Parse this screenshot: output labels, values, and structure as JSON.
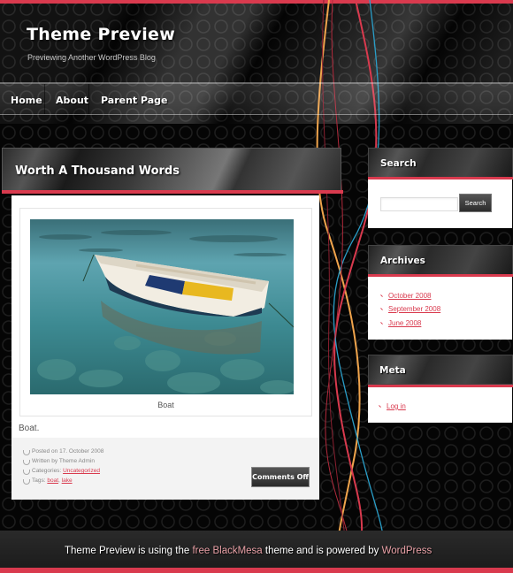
{
  "site": {
    "title": "Theme Preview",
    "description": "Previewing Another WordPress Blog"
  },
  "nav": {
    "items": [
      {
        "label": "Home"
      },
      {
        "label": "About"
      },
      {
        "label": "Parent Page"
      }
    ]
  },
  "post": {
    "title": "Worth A Thousand Words",
    "image_alt": "Boat",
    "caption": "Boat",
    "excerpt": "Boat.",
    "meta": {
      "posted": "Posted on 17. October 2008",
      "author": "Written by Theme Admin",
      "categories_label": "Categories:",
      "categories": [
        "Uncategorized"
      ],
      "tags_label": "Tags:",
      "tags": [
        "boat",
        "lake"
      ]
    },
    "comments_label": "Comments Off"
  },
  "sidebar": {
    "search": {
      "title": "Search",
      "input_value": "",
      "button_label": "Search"
    },
    "archives": {
      "title": "Archives",
      "items": [
        {
          "label": "October 2008"
        },
        {
          "label": "September 2008"
        },
        {
          "label": "June 2008"
        }
      ]
    },
    "meta": {
      "title": "Meta",
      "items": [
        {
          "label": "Log in"
        }
      ]
    }
  },
  "footer": {
    "text_1": "Theme Preview is using the ",
    "link_1": "free BlackMesa",
    "text_2": " theme and is powered by ",
    "link_2": "WordPress"
  },
  "colors": {
    "accent": "#d93a4e",
    "background": "#050505",
    "curve_orange": "#f0a44c",
    "curve_blue": "#2a9ec8"
  }
}
